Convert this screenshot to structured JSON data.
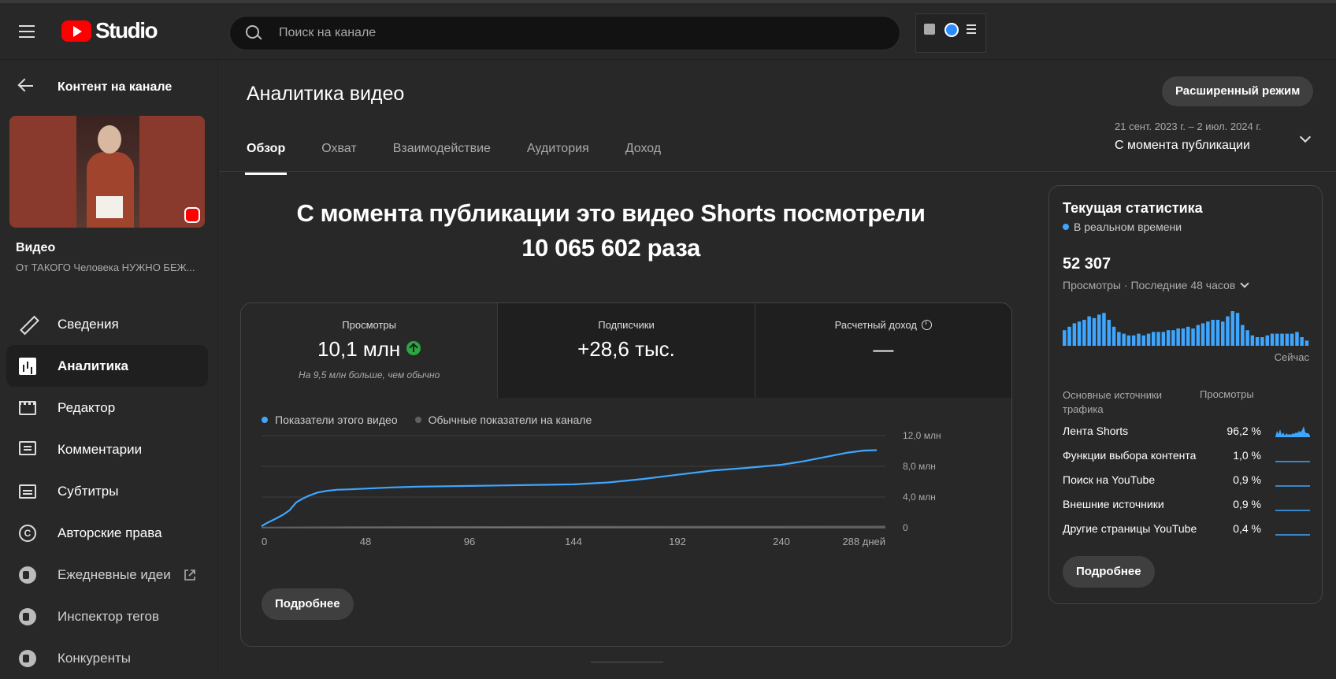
{
  "header": {
    "logo_text": "Studio",
    "search_placeholder": "Поиск на канале"
  },
  "sidebar": {
    "back_title": "Контент на канале",
    "video_label": "Видео",
    "video_title": "От ТАКОГО Человека НУЖНО БЕЖ...",
    "items": [
      {
        "label": "Сведения",
        "icon": "pencil-icon"
      },
      {
        "label": "Аналитика",
        "icon": "analytics-icon",
        "active": true
      },
      {
        "label": "Редактор",
        "icon": "clapperboard-icon"
      },
      {
        "label": "Комментарии",
        "icon": "comment-icon"
      },
      {
        "label": "Субтитры",
        "icon": "subtitles-icon"
      },
      {
        "label": "Авторские права",
        "icon": "copyright-icon"
      },
      {
        "label": "Ежедневные идеи",
        "icon": "extension-icon",
        "external": true
      },
      {
        "label": "Инспектор тегов",
        "icon": "extension-icon"
      },
      {
        "label": "Конкуренты",
        "icon": "extension-icon"
      }
    ]
  },
  "main": {
    "title": "Аналитика видео",
    "advanced_button": "Расширенный режим",
    "tabs": [
      "Обзор",
      "Охват",
      "Взаимодействие",
      "Аудитория",
      "Доход"
    ],
    "active_tab": 0,
    "date_range": {
      "dates": "21 сент. 2023 г. – 2 июл. 2024 г.",
      "label": "С момента публикации"
    },
    "headline_line1": "С момента публикации это видео Shorts посмотрели",
    "headline_line2": "10 065 602 раза",
    "metrics": [
      {
        "title": "Просмотры",
        "value": "10,1 млн",
        "sub": "На 9,5 млн больше, чем обычно",
        "trend": "up"
      },
      {
        "title": "Подписчики",
        "value": "+28,6 тыс."
      },
      {
        "title": "Расчетный доход",
        "value": "—"
      }
    ],
    "legend": {
      "this_video": "Показатели этого видео",
      "typical": "Обычные показатели на канале"
    },
    "more_button": "Подробнее"
  },
  "chart_data": {
    "type": "line",
    "xlabel": "",
    "ylabel": "",
    "x_ticks": [
      "0",
      "48",
      "96",
      "144",
      "192",
      "240",
      "288 дней"
    ],
    "y_ticks": [
      "0",
      "4,0 млн",
      "8,0 млн",
      "12,0 млн"
    ],
    "xlim": [
      0,
      288
    ],
    "ylim": [
      0,
      12000000
    ],
    "series": [
      {
        "name": "Показатели этого видео",
        "color": "#3ea6ff",
        "x": [
          0,
          3,
          6,
          10,
          13,
          16,
          19,
          22,
          26,
          30,
          35,
          40,
          48,
          60,
          72,
          96,
          120,
          144,
          160,
          176,
          192,
          208,
          224,
          240,
          250,
          260,
          270,
          278,
          284
        ],
        "y": [
          200000,
          700000,
          1100000,
          1700000,
          2300000,
          3300000,
          3800000,
          4200000,
          4600000,
          4800000,
          4950000,
          5000000,
          5100000,
          5250000,
          5350000,
          5450000,
          5550000,
          5650000,
          5900000,
          6350000,
          6900000,
          7450000,
          7800000,
          8200000,
          8650000,
          9200000,
          9750000,
          10050000,
          10100000
        ]
      },
      {
        "name": "Обычные показатели на канале",
        "color": "#606060",
        "x": [
          0,
          48,
          96,
          144,
          192,
          240,
          288
        ],
        "y": [
          50000,
          100000,
          120000,
          140000,
          150000,
          160000,
          170000
        ]
      }
    ]
  },
  "realtime": {
    "title": "Текущая статистика",
    "live_label": "В реальном времени",
    "count": "52 307",
    "views_label": "Просмотры · Последние 48 часов",
    "now_label": "Сейчас",
    "hourly_bars": [
      9,
      11,
      13,
      14,
      15,
      17,
      16,
      18,
      19,
      15,
      11,
      8,
      7,
      6,
      6,
      7,
      6,
      7,
      8,
      8,
      8,
      9,
      9,
      10,
      10,
      11,
      10,
      12,
      13,
      14,
      15,
      15,
      14,
      17,
      20,
      19,
      12,
      9,
      6,
      5,
      5,
      6,
      7,
      7,
      7,
      7,
      7,
      8,
      5,
      3
    ],
    "sources_header": "Основные источники трафика",
    "views_header": "Просмотры",
    "sources": [
      {
        "name": "Лента Shorts",
        "pct": "96,2 %"
      },
      {
        "name": "Функции выбора контента",
        "pct": "1,0 %"
      },
      {
        "name": "Поиск на YouTube",
        "pct": "0,9 %"
      },
      {
        "name": "Внешние источники",
        "pct": "0,9 %"
      },
      {
        "name": "Другие страницы YouTube",
        "pct": "0,4 %"
      }
    ],
    "more_button": "Подробнее"
  },
  "colors": {
    "accent": "#3ea6ff",
    "background": "#282828",
    "up_green": "#2ba640"
  }
}
